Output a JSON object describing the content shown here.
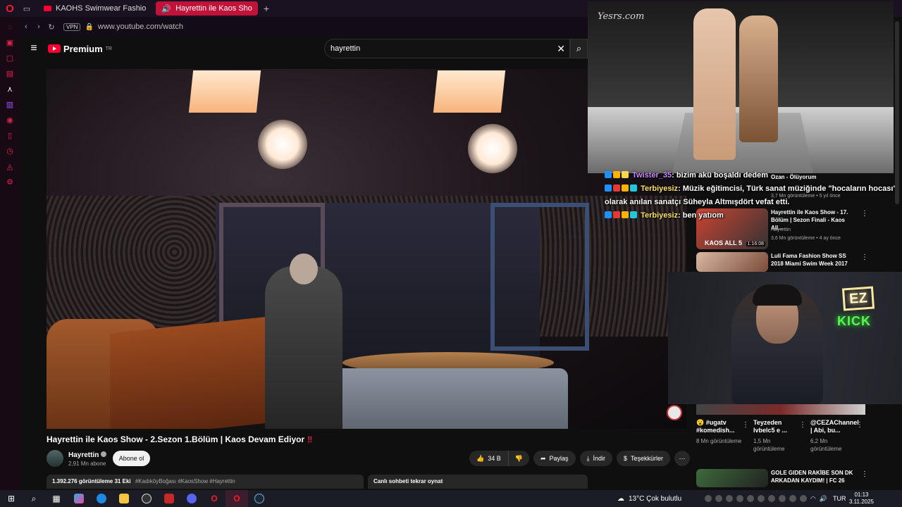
{
  "browser": {
    "tabs": [
      {
        "label": "KAOHS Swimwear Fashio",
        "active": false
      },
      {
        "label": "Hayrettin ile Kaos Sho",
        "active": true
      }
    ],
    "url": "www.youtube.com/watch",
    "vpn_label": "VPN"
  },
  "yt": {
    "logo": "Premium",
    "logo_sup": "TR",
    "search_value": "hayrettin"
  },
  "video": {
    "title": "Hayrettin ile Kaos Show - 2.Sezon 1.Bölüm | Kaos Devam Ediyor",
    "title_suffix": "‼",
    "channel": "Hayrettin",
    "subscribers": "2,91 Mn abone",
    "subscribe_label": "Abone ol",
    "likes": "34 B",
    "share_label": "Paylaş",
    "download_label": "İndir",
    "thanks_label": "Teşekkürler",
    "views_line": "1.392.276 görüntüleme  31 Eki",
    "hashtags": "#KadıköyBoğası #KaosShow #Hayrettin",
    "chat_replay_label": "Canlı sohbeti tekrar oynat"
  },
  "overlay_stream": {
    "watermark": "Yesrs.com"
  },
  "chat": [
    {
      "user": "Twister_35",
      "message": ": bizim akü boşaldı dedem"
    },
    {
      "user": "Terbiyesiz",
      "message": ": Müzik eğitimcisi, Türk sanat müziğinde \"hocaların hocası\" olarak anılan sanatçı Süheyla Altmışdört vefat etti."
    },
    {
      "user": "Terbiyesiz",
      "message": ": ben yatıom"
    }
  ],
  "recommendations": [
    {
      "title": "Ozan - Ölüyorum",
      "meta": "3,7 Mn görüntüleme • 5 yıl önce",
      "duration": ""
    },
    {
      "title": "Hayrettin ile Kaos Show - 17. Bölüm | Sezon Finali - Kaos All...",
      "channel": "Hayrettin",
      "meta": "3,6 Mn görüntüleme • 4 ay önce",
      "duration": "1:16:08",
      "thumb_text": "KAOS ALL 5"
    },
    {
      "title": "Luli Fama Fashion Show SS 2018 Miami Swim Week 2017",
      "meta": "",
      "duration": ""
    },
    {
      "title": "GOLE GIDEN RAKİBE SON DK ARKADAN KAYDIM! | FC 26",
      "meta": "",
      "duration": ""
    }
  ],
  "shorts": [
    {
      "title": "😮 #ugatv #komedish...",
      "views": "8 Mn görüntüleme"
    },
    {
      "title": "Teyzeden lvbelc5 e ...",
      "views": "1,5 Mn görüntüleme"
    },
    {
      "title": "@CEZAChannel | Abi, bu...",
      "views": "6,2 Mn görüntüleme"
    }
  ],
  "webcam": {
    "sign1": "EZ",
    "sign2": "KICK"
  },
  "taskbar": {
    "weather": "13°C  Çok bulutlu",
    "language": "TUR",
    "time": "01:13",
    "date": "3.11.2025"
  },
  "colors": {
    "accent": "#ff0033",
    "opera": "#ff1b2d",
    "kick": "#52ff4f"
  }
}
